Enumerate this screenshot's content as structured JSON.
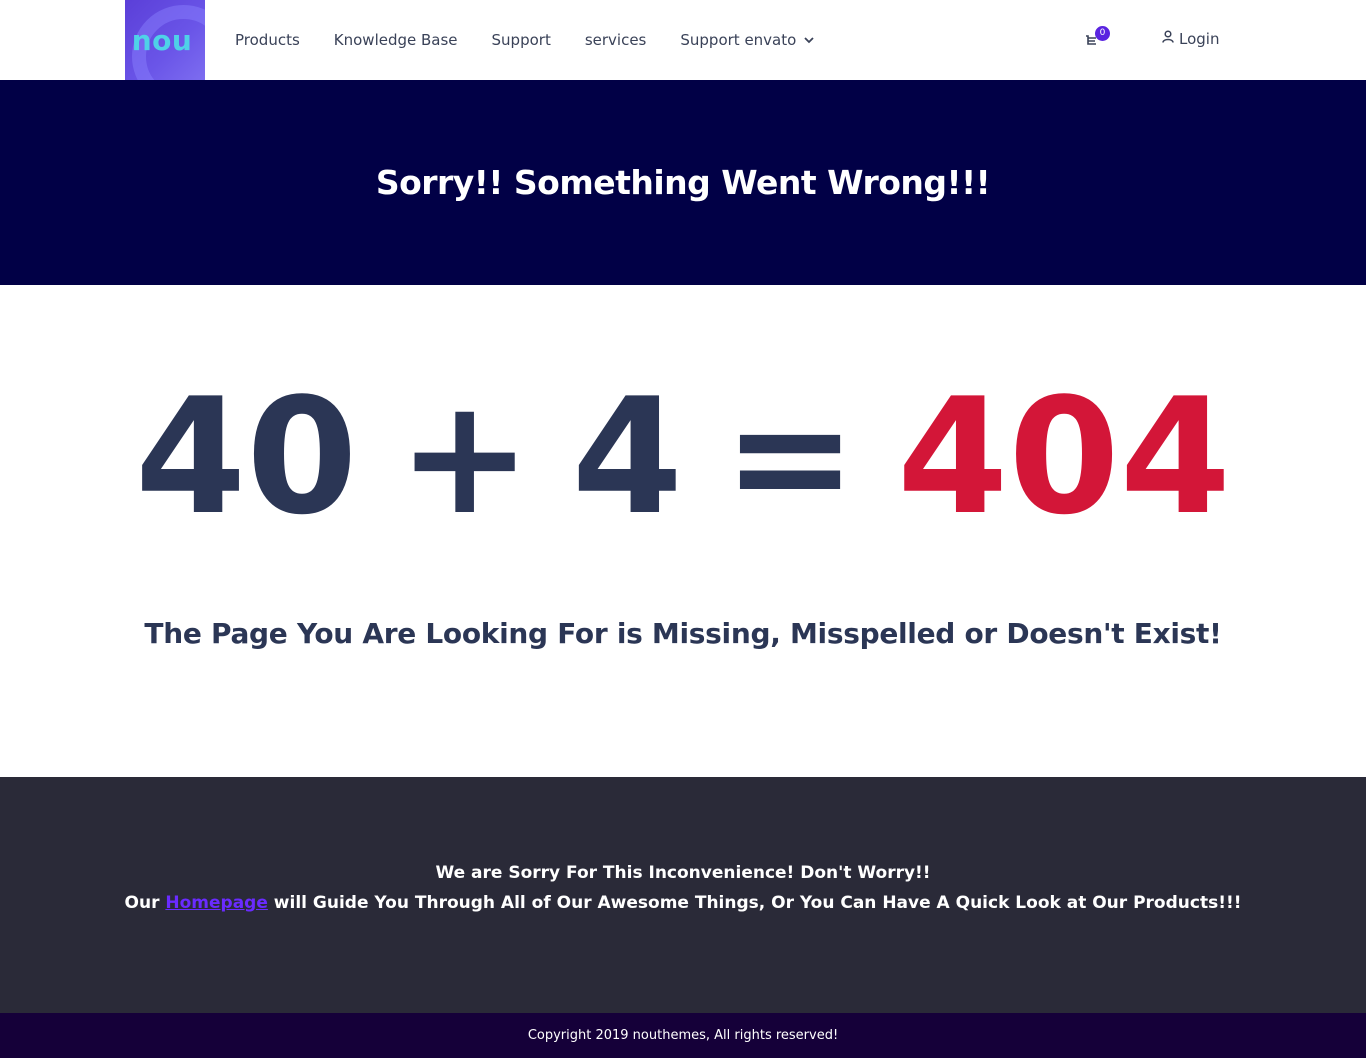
{
  "header": {
    "logo_text": "nou",
    "nav": [
      {
        "label": "Products"
      },
      {
        "label": "Knowledge Base"
      },
      {
        "label": "Support"
      },
      {
        "label": "services"
      },
      {
        "label": "Support envato"
      }
    ],
    "cart_count": "0",
    "login_label": "Login"
  },
  "banner": {
    "title": "Sorry!! Something Went Wrong!!!"
  },
  "main": {
    "equation": {
      "a": "40",
      "plus": "+",
      "b": "4",
      "equals": "=",
      "result": "404"
    },
    "subtitle": "The Page You Are Looking For is Missing, Misspelled or Doesn't Exist!"
  },
  "info": {
    "line1": "We are Sorry For This Inconvenience! Don't Worry!!",
    "line2_prefix": "Our ",
    "homepage_link": "Homepage",
    "line2_suffix": " will Guide You Through All of Our Awesome Things, Or You Can Have A Quick Look at Our Products!!!"
  },
  "footer": {
    "copyright": "Copyright 2019 nouthemes, All rights reserved!"
  },
  "colors": {
    "banner_bg": "#010046",
    "accent_red": "#d31638",
    "text_dark": "#2b3655",
    "dark_section_bg": "#2a2a38",
    "footer_bg": "#150039",
    "link_purple": "#6a2bff"
  }
}
